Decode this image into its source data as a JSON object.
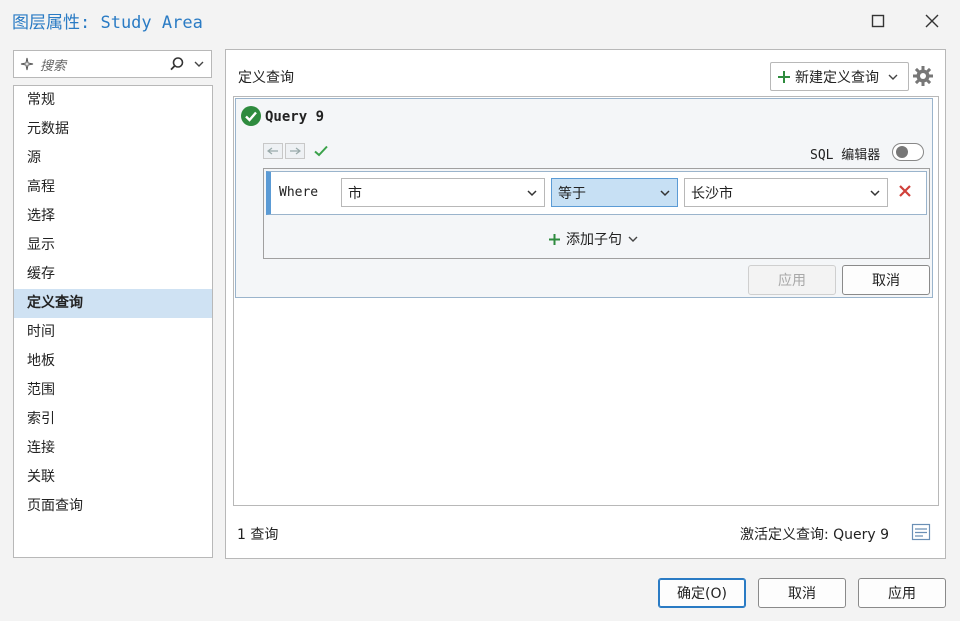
{
  "window": {
    "title": "图层属性: Study Area"
  },
  "search": {
    "placeholder": "搜索"
  },
  "sidebar": {
    "items": [
      {
        "label": "常规"
      },
      {
        "label": "元数据"
      },
      {
        "label": "源"
      },
      {
        "label": "高程"
      },
      {
        "label": "选择"
      },
      {
        "label": "显示"
      },
      {
        "label": "缓存"
      },
      {
        "label": "定义查询"
      },
      {
        "label": "时间"
      },
      {
        "label": "地板"
      },
      {
        "label": "范围"
      },
      {
        "label": "索引"
      },
      {
        "label": "连接"
      },
      {
        "label": "关联"
      },
      {
        "label": "页面查询"
      }
    ],
    "active_index": 7
  },
  "main": {
    "heading": "定义查询",
    "new_query_label": "新建定义查询",
    "query": {
      "name": "Query 9",
      "sql_label": "SQL 编辑器",
      "sql_editor_on": false,
      "clause": {
        "keyword": "Where",
        "field": "市",
        "operator": "等于",
        "value": "长沙市"
      },
      "add_clause_label": "添加子句",
      "apply_label": "应用",
      "cancel_label": "取消"
    },
    "query_count": "1 查询",
    "active_query_label": "激活定义查询: Query 9"
  },
  "footer": {
    "ok_label": "确定(O)",
    "cancel_label": "取消",
    "apply_label": "应用"
  },
  "colors": {
    "accent": "#2a7bc4",
    "success": "#2e8b3e",
    "delete": "#d0403a",
    "selection": "#cfe2f3"
  }
}
